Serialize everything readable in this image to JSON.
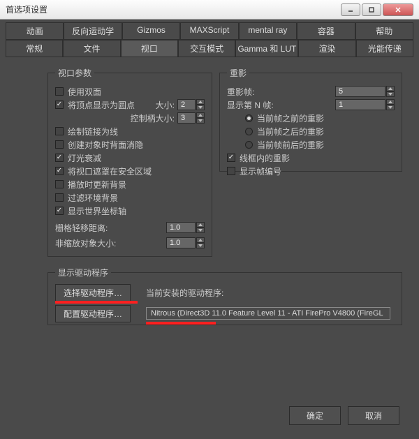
{
  "window": {
    "title": "首选项设置"
  },
  "tabs_row1": [
    "动画",
    "反向运动学",
    "Gizmos",
    "MAXScript",
    "mental ray",
    "容器",
    "帮助"
  ],
  "tabs_row2": [
    "常规",
    "文件",
    "视口",
    "交互模式",
    "Gamma 和 LUT",
    "渲染",
    "光能传递"
  ],
  "viewParams": {
    "legend": "视口参数",
    "use_dual": "使用双面",
    "vertex_dots": "将顶点显示为圆点",
    "size_lbl": "大小:",
    "size_val": "2",
    "handle_lbl": "控制柄大小:",
    "handle_val": "3",
    "draw_links": "绘制链接为线",
    "backface": "创建对象时背面消隐",
    "light_atten": "灯光衰减",
    "safe_frame": "将视口遮罩在安全区域",
    "play_update": "播放时更新背景",
    "filter_bg": "过滤环境背景",
    "world_axis": "显示世界坐标轴",
    "grid_dist_lbl": "栅格轻移距离:",
    "grid_dist_val": "1.0",
    "nonscale_lbl": "非缩放对象大小:",
    "nonscale_val": "1.0"
  },
  "ghost": {
    "legend": "重影",
    "ghost_frames_lbl": "重影帧:",
    "ghost_frames_val": "5",
    "nth_lbl": "显示第 N 帧:",
    "nth_val": "1",
    "before": "当前帧之前的重影",
    "after": "当前帧之后的重影",
    "both": "当前帧前后的重影",
    "wire": "线框内的重影",
    "shownum": "显示帧编号"
  },
  "driver": {
    "legend": "显示驱动程序",
    "choose_btn": "选择驱动程序…",
    "config_btn": "配置驱动程序…",
    "installed_lbl": "当前安装的驱动程序:",
    "installed_val": "Nitrous (Direct3D 11.0 Feature Level 11 - ATI FirePro V4800 (FireGL"
  },
  "footer": {
    "ok": "确定",
    "cancel": "取消"
  }
}
